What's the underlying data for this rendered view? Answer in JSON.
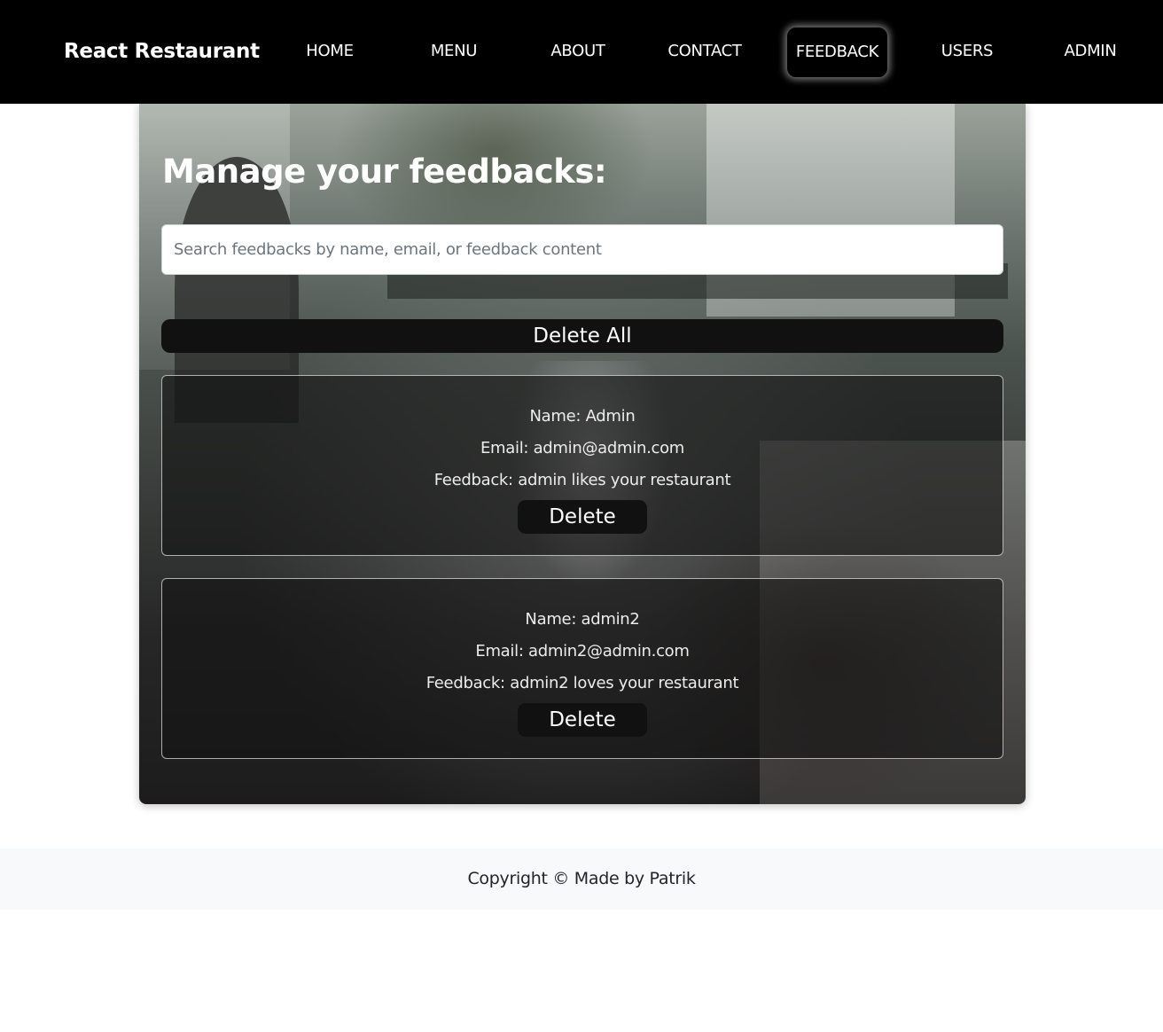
{
  "navbar": {
    "brand": "React Restaurant",
    "items": [
      {
        "label": "HOME"
      },
      {
        "label": "MENU"
      },
      {
        "label": "ABOUT"
      },
      {
        "label": "CONTACT"
      },
      {
        "label": "FEEDBACK",
        "active": true
      },
      {
        "label": "USERS"
      },
      {
        "label": "ADMIN"
      }
    ]
  },
  "main": {
    "title": "Manage your feedbacks:",
    "search": {
      "placeholder": "Search feedbacks by name, email, or feedback content",
      "value": ""
    },
    "delete_all_label": "Delete All",
    "feedbacks": [
      {
        "name": "Name: Admin",
        "email": "Email: admin@admin.com",
        "feedback": "Feedback: admin likes your restaurant",
        "delete_label": "Delete"
      },
      {
        "name": "Name: admin2",
        "email": "Email: admin2@admin.com",
        "feedback": "Feedback: admin2 loves your restaurant",
        "delete_label": "Delete"
      }
    ]
  },
  "footer": {
    "text": "Copyright © Made by Patrik"
  },
  "colors": {
    "navbar_bg": "#000000",
    "button_bg": "#111111",
    "footer_bg": "#f8f9fa"
  }
}
